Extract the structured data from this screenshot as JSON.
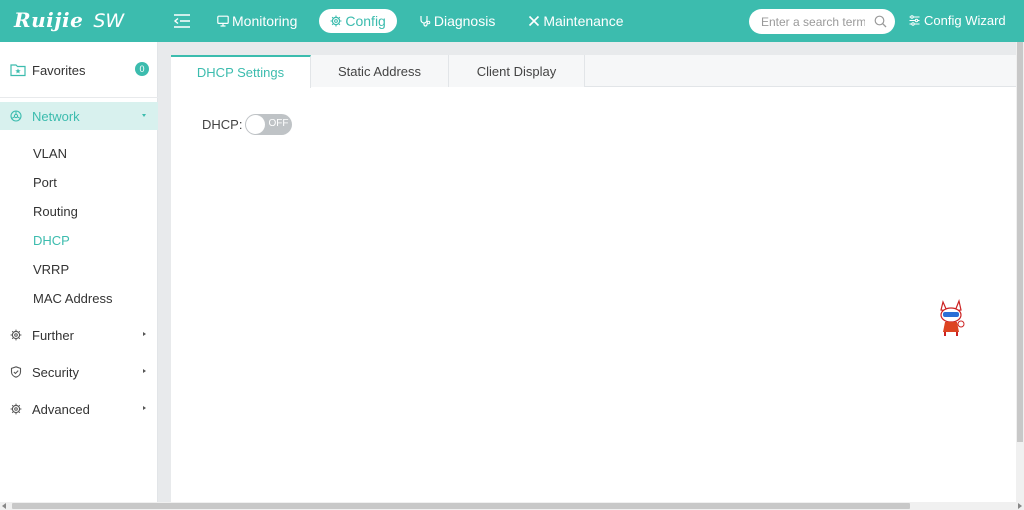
{
  "header": {
    "brand": "Ruijie",
    "product": "SW",
    "nav": [
      {
        "label": "Monitoring",
        "icon": "monitor-icon"
      },
      {
        "label": "Config",
        "icon": "gear-icon",
        "active": true
      },
      {
        "label": "Diagnosis",
        "icon": "stethoscope-icon"
      },
      {
        "label": "Maintenance",
        "icon": "tools-icon"
      }
    ],
    "search_placeholder": "Enter a search term",
    "config_wizard": "Config Wizard",
    "accent_color": "#3cbcae"
  },
  "sidebar": {
    "favorites": {
      "label": "Favorites",
      "count": "0"
    },
    "groups": [
      {
        "label": "Network",
        "icon": "network-icon",
        "open": true,
        "items": [
          "VLAN",
          "Port",
          "Routing",
          "DHCP",
          "VRRP",
          "MAC Address"
        ],
        "active_item": "DHCP"
      },
      {
        "label": "Further",
        "icon": "gear-icon",
        "open": false
      },
      {
        "label": "Security",
        "icon": "shield-icon",
        "open": false
      },
      {
        "label": "Advanced",
        "icon": "gear-icon",
        "open": false
      }
    ]
  },
  "main": {
    "tabs": [
      {
        "label": "DHCP Settings",
        "active": true
      },
      {
        "label": "Static Address",
        "active": false
      },
      {
        "label": "Client Display",
        "active": false
      }
    ],
    "dhcp": {
      "label": "DHCP:",
      "state": "OFF"
    }
  }
}
